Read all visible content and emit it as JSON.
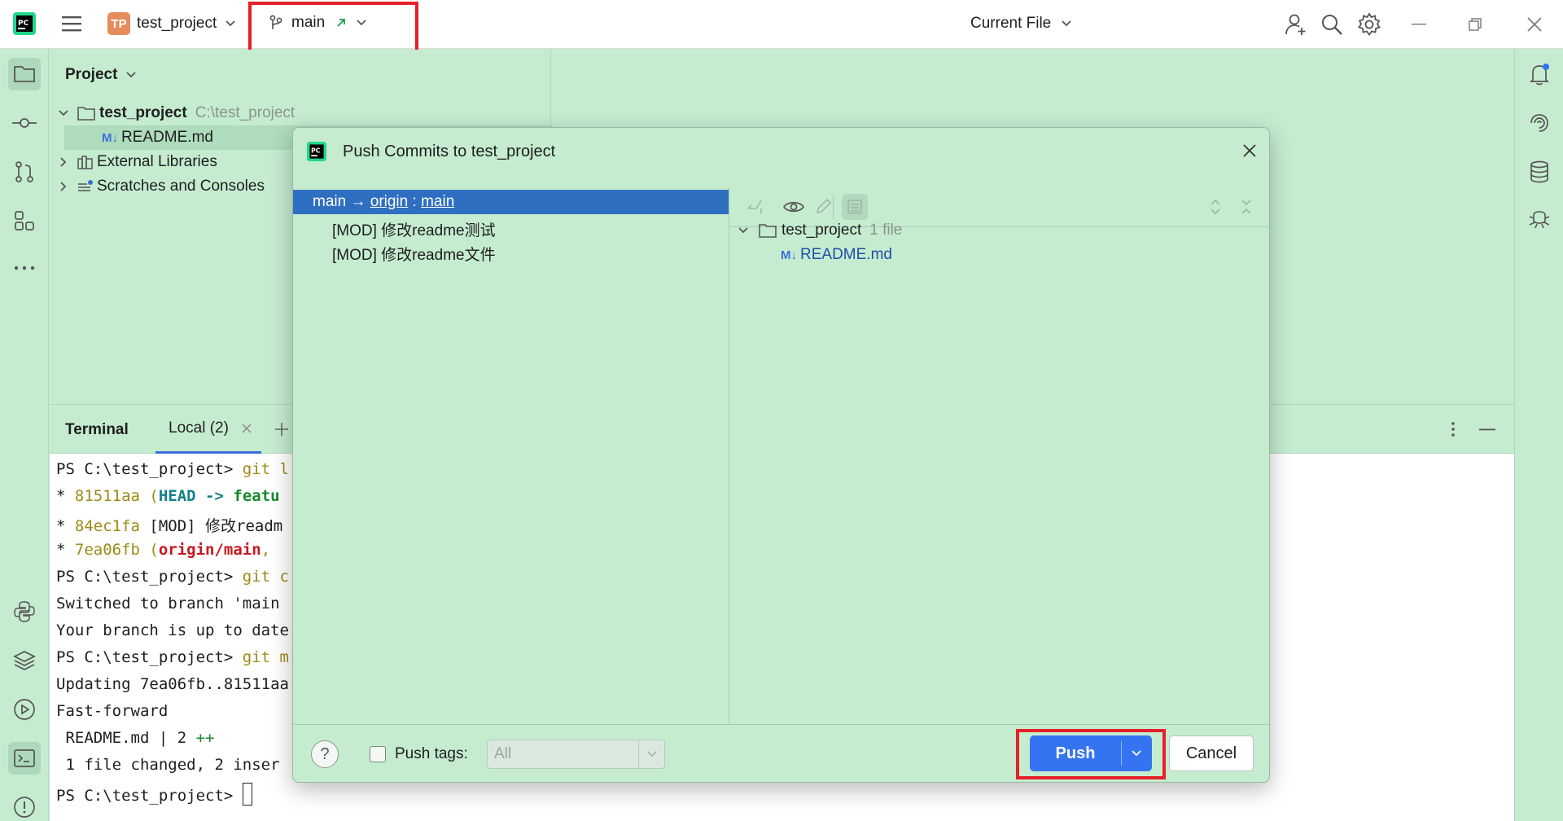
{
  "titlebar": {
    "project_badge": "TP",
    "project_name": "test_project",
    "branch": "main",
    "run_config": "Current File"
  },
  "project_panel": {
    "title": "Project",
    "tree": [
      {
        "label": "test_project",
        "path": "C:\\test_project"
      },
      {
        "label": "README.md",
        "icon_text": "M↓"
      },
      {
        "label": "External Libraries"
      },
      {
        "label": "Scratches and Consoles"
      }
    ]
  },
  "terminal": {
    "title": "Terminal",
    "tab": "Local (2)",
    "lines": [
      {
        "prompt": "PS C:\\test_project> ",
        "cmd": "git l"
      },
      {
        "star": "* ",
        "hash": "81511aa",
        "open": " (",
        "head": "HEAD -> ",
        "branch": "featu"
      },
      {
        "star": "* ",
        "hash": "84ec1fa",
        "rest": " [MOD] 修改readm"
      },
      {
        "star": "* ",
        "hash": "7ea06fb",
        "open": " (",
        "origin": "origin/main",
        "rest": ", "
      },
      {
        "prompt": "PS C:\\test_project> ",
        "cmd": "git c"
      },
      {
        "text": "Switched to branch 'main"
      },
      {
        "text": "Your branch is up to date"
      },
      {
        "prompt": "PS C:\\test_project> ",
        "cmd": "git m"
      },
      {
        "text": "Updating 7ea06fb..81511aa"
      },
      {
        "text": "Fast-forward"
      },
      {
        "text": " README.md | 2 ",
        "plus": "++"
      },
      {
        "text": " 1 file changed, 2 inser"
      },
      {
        "prompt": "PS C:\\test_project> "
      }
    ]
  },
  "dialog": {
    "title": "Push Commits to test_project",
    "push_spec": {
      "local": "main",
      "arrow": " → ",
      "remote": "origin",
      "sep": " : ",
      "remote_branch": "main"
    },
    "commits": [
      "[MOD] 修改readme测试",
      "[MOD] 修改readme文件"
    ],
    "changes_root": {
      "label": "test_project",
      "count": "1 file"
    },
    "changed_file": {
      "icon_text": "M↓",
      "label": "README.md"
    },
    "push_tags_label": "Push tags:",
    "push_tags_value": "All",
    "push_button": "Push",
    "cancel_button": "Cancel",
    "help": "?"
  },
  "colors": {
    "background": "#c6ecd0",
    "selection": "#2f6fc2",
    "accent_button": "#3574f0",
    "highlight_box": "#e5202a"
  }
}
